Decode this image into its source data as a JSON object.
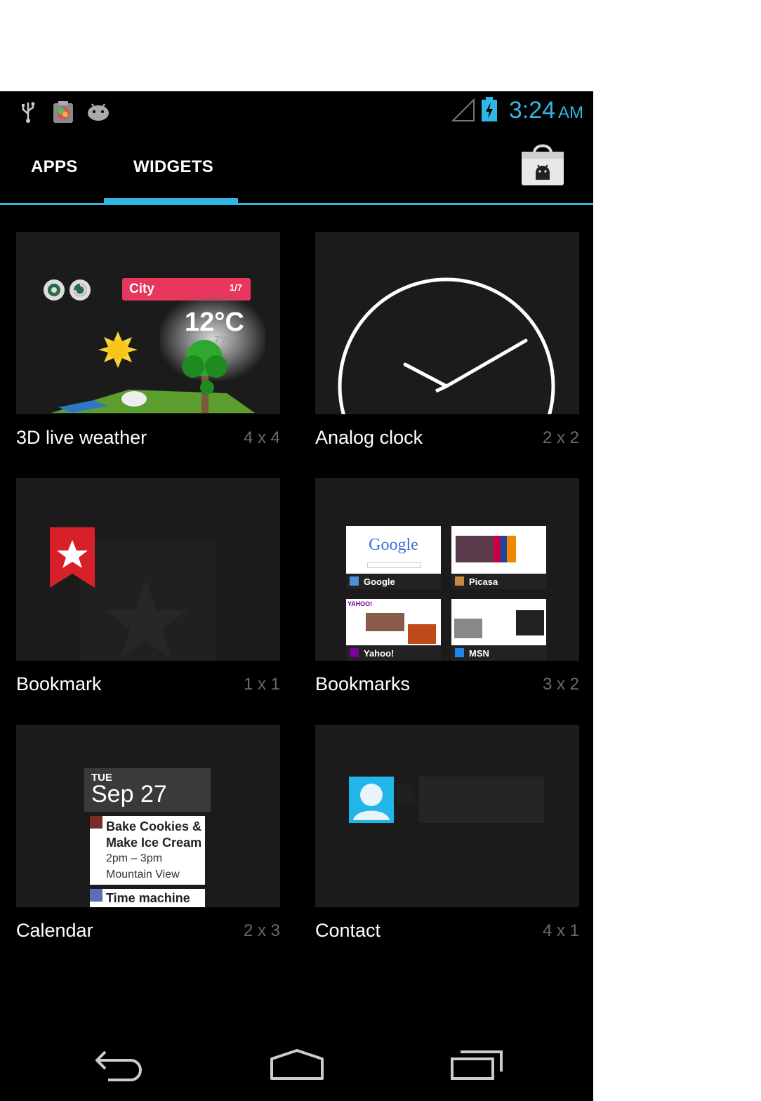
{
  "status_bar": {
    "notification_icons": [
      "usb-icon",
      "gallery-icon",
      "android-icon"
    ],
    "system_icons": [
      "signal-icon",
      "battery-charging-icon"
    ],
    "time": "3:24",
    "ampm": "AM"
  },
  "tabs": [
    {
      "label": "APPS",
      "selected": false
    },
    {
      "label": "WIDGETS",
      "selected": true
    }
  ],
  "store_icon": "play-store-icon",
  "accent_color": "#33b5e5",
  "widgets": [
    {
      "name": "3D live weather",
      "size": "4 x 4",
      "preview": {
        "city": "City",
        "page": "1/7",
        "temp": "12°C",
        "range": "7°/14°"
      }
    },
    {
      "name": "Analog clock",
      "size": "2 x 2"
    },
    {
      "name": "Bookmark",
      "size": "1 x 1"
    },
    {
      "name": "Bookmarks",
      "size": "3 x 2",
      "preview": {
        "thumbs": [
          "Google",
          "Picasa",
          "Yahoo!",
          "MSN"
        ],
        "google_logo": "Google"
      }
    },
    {
      "name": "Calendar",
      "size": "2 x 3",
      "preview": {
        "dow": "TUE",
        "date": "Sep 27",
        "event1_line1": "Bake Cookies &",
        "event1_line2": "Make Ice Cream",
        "event1_time": "2pm – 3pm",
        "event1_location": "Mountain View",
        "event2_title": "Time machine"
      }
    },
    {
      "name": "Contact",
      "size": "4 x 1"
    }
  ],
  "nav_buttons": [
    "back-icon",
    "home-icon",
    "recent-apps-icon"
  ]
}
